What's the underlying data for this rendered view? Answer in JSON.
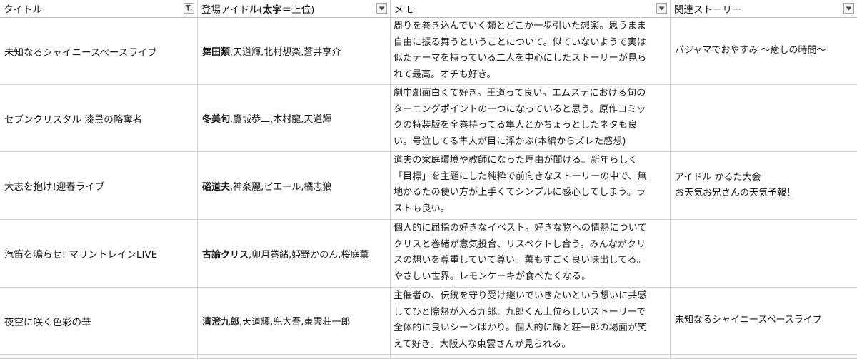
{
  "headers": {
    "title": "タイトル",
    "idols_prefix": "登場アイドル(",
    "idols_bold": "太字",
    "idols_suffix": "＝上位)",
    "memo": "メモ",
    "related": "関連ストーリー"
  },
  "icons": {
    "filter_active": "filter-active-icon",
    "dropdown": "dropdown-arrow-icon"
  },
  "rows": [
    {
      "title": "未知なるシャイニースペースライブ",
      "lead_idol": "舞田類",
      "other_idols": ",天道輝,北村想楽,蒼井享介",
      "memo": [
        "周りを巻き込んでいく類とどこか一歩引いた想楽。思うまま",
        "自由に振る舞うということについて。似ていないようで実は",
        "似たテーマを持っている二人を中心にしたストーリーが見ら",
        "れて最高。オチも好き。"
      ],
      "related": [
        "パジャマでおやすみ 〜癒しの時間〜"
      ]
    },
    {
      "title": "セブンクリスタル 漆黒の略奪者",
      "lead_idol": "冬美旬",
      "other_idols": ",鷹城恭二,木村龍,天道輝",
      "memo": [
        "劇中劇面白くて好き。王道って良い。エムステにおける旬の",
        "ターニングポイントの一つになっていると思う。原作コミッ",
        "クの特装版を全巻持ってる隼人とかちょっとしたネタも良",
        "い。号泣してる隼人が目に浮かぶ(本編からズレた感想)"
      ],
      "related": []
    },
    {
      "title": "大志を抱け!迎春ライブ",
      "lead_idol": "硲道夫",
      "other_idols": ",神楽麗,ピエール,橘志狼",
      "memo": [
        "道夫の家庭環境や教師になった理由が聞ける。新年らしく",
        "「目標」を主題にした純粋で前向きなストーリーの中で、無",
        "地かるたの使い方が上手くてシンプルに感心してしまう。ラ",
        "ストも良い。"
      ],
      "related": [
        "アイドル かるた大会",
        "お天気お兄さんの天気予報！"
      ]
    },
    {
      "title": "汽笛を鳴らせ! マリントレインLIVE",
      "lead_idol": "古論クリス",
      "other_idols": ",卯月巻緒,姫野かのん,桜庭薫",
      "memo": [
        "個人的に屈指の好きなイベスト。好きな物への情熱について",
        "クリスと巻緒が意気投合、リスペクトし合う。みんながクリ",
        "スの想いを尊重していて尊い。薫もすごく良い味出してる。",
        "やさしい世界。レモンケーキが食べたくなる。"
      ],
      "related": []
    },
    {
      "title": "夜空に咲く色彩の華",
      "lead_idol": "清澄九郎",
      "other_idols": ",天道輝,兜大吾,東雲荘一郎",
      "memo": [
        "主催者の、伝統を守り受け継いでいきたいという想いに共感",
        "してひと際熱が入る九郎。九郎くん上位らしいストーリーで",
        "全体的に良いシーンばかり。個人的に輝と荘一郎の場面が笑",
        "えて好き。大阪人な東雲さんが見られる。"
      ],
      "related": [
        "未知なるシャイニースペースライブ"
      ]
    }
  ]
}
